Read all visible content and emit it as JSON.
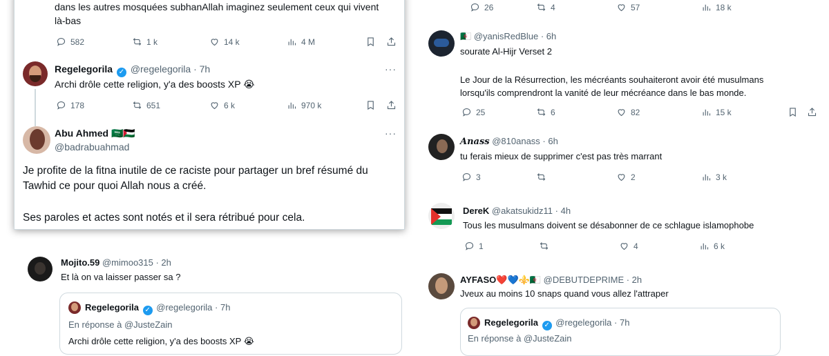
{
  "left": {
    "top_tweet": {
      "text_line1": "dans les autres mosquées subhanAllah imaginez seulement ceux qui vivent",
      "text_line2": "là-bas",
      "replies": "582",
      "retweets": "1 k",
      "likes": "14 k",
      "views": "4 M"
    },
    "reply1": {
      "name": "Regelegorila",
      "handle": "@regelegorila · 7h",
      "text": "Archi drôle cette religion, y'a des boosts XP 😭",
      "replies": "178",
      "retweets": "651",
      "likes": "6 k",
      "views": "970 k"
    },
    "reply2": {
      "name": "Abu Ahmed",
      "flags": "🇸🇦🇵🇸",
      "handle": "@badrabuahmad",
      "p1": "Je profite de la fitna inutile de ce raciste pour partager un bref résumé du Tawhid ce pour quoi Allah nous a créé.",
      "p2": "Ses paroles et actes sont notés et il sera rétribué pour cela."
    },
    "mojito": {
      "name": "Mojito.59",
      "handle": "@mimoo315 · 2h",
      "text": "Et là on va laisser passer sa ?",
      "quote_name": "Regelegorila",
      "quote_handle": "@regelegorila · 7h",
      "quote_reply_to": "En réponse à @JusteZain",
      "quote_text": "Archi drôle cette religion, y'a des boosts XP 😭"
    }
  },
  "right": {
    "top_actions": {
      "replies": "26",
      "retweets": "4",
      "likes": "57",
      "views": "18 k"
    },
    "yanis": {
      "flag": "🇩🇿",
      "handle": "@yanisRedBlue · 6h",
      "line1": "sourate Al-Hijr Verset 2",
      "line2": "Le Jour de la Résurrection, les mécréants souhaiteront avoir été musulmans",
      "line3": "lorsqu'ils comprendront la vanité de leur mécréance dans le bas monde.",
      "replies": "25",
      "retweets": "6",
      "likes": "82",
      "views": "15 k"
    },
    "anass": {
      "name": "𝑨𝒏𝒂𝒔𝒔",
      "handle": "@810anass · 6h",
      "text": "tu ferais mieux de supprimer c'est pas très marrant",
      "replies": "3",
      "retweets": "",
      "likes": "2",
      "views": "3 k"
    },
    "derek": {
      "name": "DereK",
      "handle": "@akatsukidz11 · 4h",
      "text": "Tous les musulmans doivent se désabonner de ce schlague islamophobe",
      "replies": "1",
      "retweets": "",
      "likes": "4",
      "views": "6 k"
    },
    "ayfaso": {
      "name": "AYFASO❤️💙⚜️🇩🇿",
      "handle": "@DEBUTDEPRIME · 2h",
      "text": "Jveux au moins 10 snaps quand vous allez l'attraper",
      "quote_name": "Regelegorila",
      "quote_handle": "@regelegorila · 7h",
      "quote_reply_to": "En réponse à @JusteZain"
    }
  },
  "colors": {
    "accent": "#1d9bf0",
    "muted": "#536471",
    "text": "#0f1419"
  }
}
